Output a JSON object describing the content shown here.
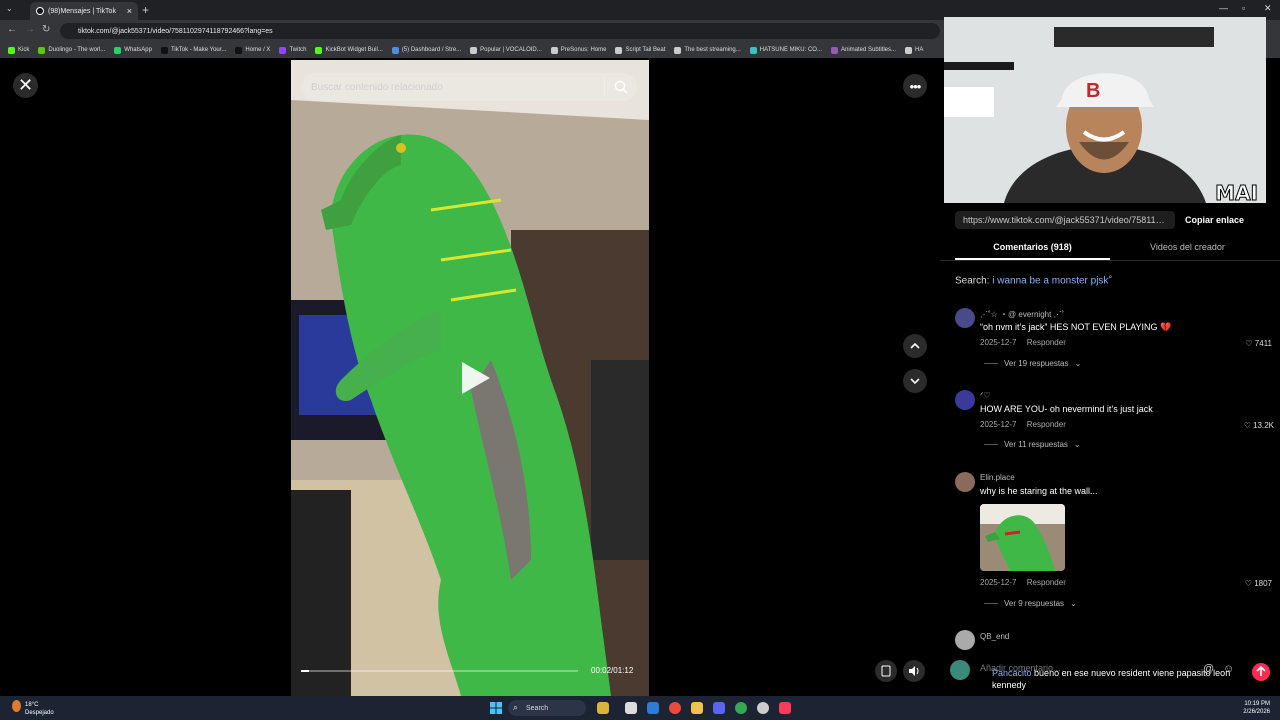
{
  "browser": {
    "tab_title": "(98)Mensajes | TikTok",
    "url": "tiktok.com/@jack55371/video/7581102974118792466?lang=es",
    "bookmarks": [
      {
        "label": "Kick",
        "color": "#53fc18"
      },
      {
        "label": "Duolingo - The worl...",
        "color": "#58cc02"
      },
      {
        "label": "WhatsApp",
        "color": "#25d366"
      },
      {
        "label": "TikTok - Make Your...",
        "color": "#111111"
      },
      {
        "label": "Home / X",
        "color": "#111111"
      },
      {
        "label": "Twitch",
        "color": "#9146ff"
      },
      {
        "label": "KickBot Widget Buil...",
        "color": "#53fc18"
      },
      {
        "label": "(5) Dashboard / Stre...",
        "color": "#4a90e2"
      },
      {
        "label": "Popular | VOCALOID...",
        "color": "#cccccc"
      },
      {
        "label": "PreSonus: Home",
        "color": "#cccccc"
      },
      {
        "label": "Script Tail Beat",
        "color": "#cccccc"
      },
      {
        "label": "The best streaming...",
        "color": "#cccccc"
      },
      {
        "label": "HATSUNE MIKU: CO...",
        "color": "#39c5bb"
      },
      {
        "label": "Animated Subtitles...",
        "color": "#9b59b6"
      },
      {
        "label": "HA",
        "color": "#cccccc"
      }
    ]
  },
  "video": {
    "search_placeholder": "Buscar contenido relacionado",
    "time": "00:02/01:12",
    "progress": 0.028
  },
  "webcam": {
    "overlay_text": "MAI"
  },
  "panel": {
    "link": "https://www.tiktok.com/@jack55371/video/758110...",
    "copy_label": "Copiar enlace",
    "tab_comments": "Comentarios (918)",
    "tab_videos": "Videos del creador",
    "search_prefix": "Search:",
    "search_query": "i wanna be a monster pjsk",
    "comments": [
      {
        "user": "⋰˚☆ ・@ evernight ⋰˚",
        "text": "“oh nvm it’s jack” HES NOT EVEN PLAYING 💔",
        "date": "2025-12-7",
        "reply": "Responder",
        "likes": "7411",
        "replies": "Ver 19 respuestas",
        "avatar": "#4a4a8a"
      },
      {
        "user": "ᐟ♡",
        "text": "HOW ARE YOU- oh nevermind it’s just jack",
        "date": "2025-12-7",
        "reply": "Responder",
        "likes": "13.2K",
        "replies": "Ver 11 respuestas",
        "avatar": "#3a3a9a"
      },
      {
        "user": "Elin.place",
        "text": "why is he staring at the wall...",
        "date": "2025-12-7",
        "reply": "Responder",
        "likes": "1807",
        "replies": "Ver 9 respuestas",
        "avatar": "#8a6a5a"
      },
      {
        "user": "QB_end",
        "avatar": "#aaaaaa"
      }
    ],
    "add_comment": "Añadir comentario...",
    "chat_user": "Pancacito",
    "chat_text": "bueno en ese nuevo resident viene papasito leon kennedy"
  },
  "taskbar": {
    "weather_temp": "18°C",
    "weather_desc": "Despejado",
    "search": "Search",
    "time": "10:19 PM",
    "date": "2/26/2026"
  }
}
